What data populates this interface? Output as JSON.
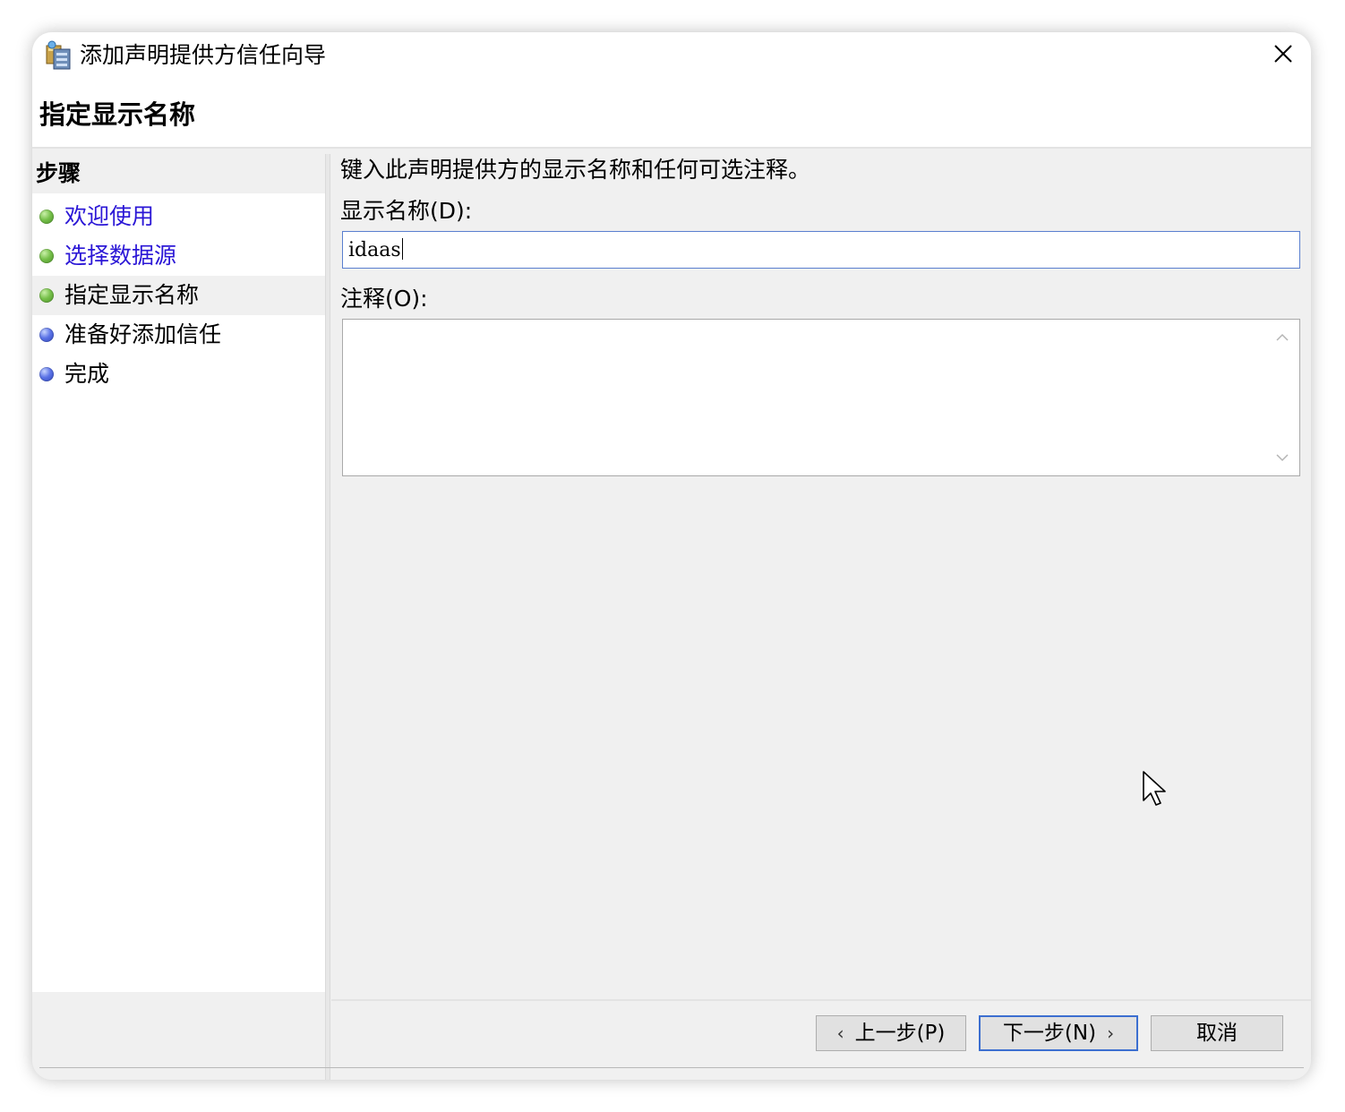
{
  "window": {
    "title": "添加声明提供方信任向导",
    "icon": "server-wizard-icon"
  },
  "header": {
    "page_title": "指定显示名称"
  },
  "sidebar": {
    "title": "步骤",
    "items": [
      {
        "label": "欢迎使用",
        "state": "completed-link",
        "bullet": "green"
      },
      {
        "label": "选择数据源",
        "state": "completed-link",
        "bullet": "green"
      },
      {
        "label": "指定显示名称",
        "state": "current",
        "bullet": "green"
      },
      {
        "label": "准备好添加信任",
        "state": "pending",
        "bullet": "blue"
      },
      {
        "label": "完成",
        "state": "pending",
        "bullet": "blue"
      }
    ]
  },
  "main": {
    "instruction": "键入此声明提供方的显示名称和任何可选注释。",
    "display_name_label": "显示名称(D):",
    "display_name_value": "idaas",
    "notes_label": "注释(O):",
    "notes_value": ""
  },
  "footer": {
    "back_label": "上一步(P)",
    "next_label": "下一步(N)",
    "cancel_label": "取消"
  },
  "colors": {
    "link": "#2b17d6",
    "focus_border": "#5a7fcf",
    "panel_bg": "#f0f0f0"
  }
}
